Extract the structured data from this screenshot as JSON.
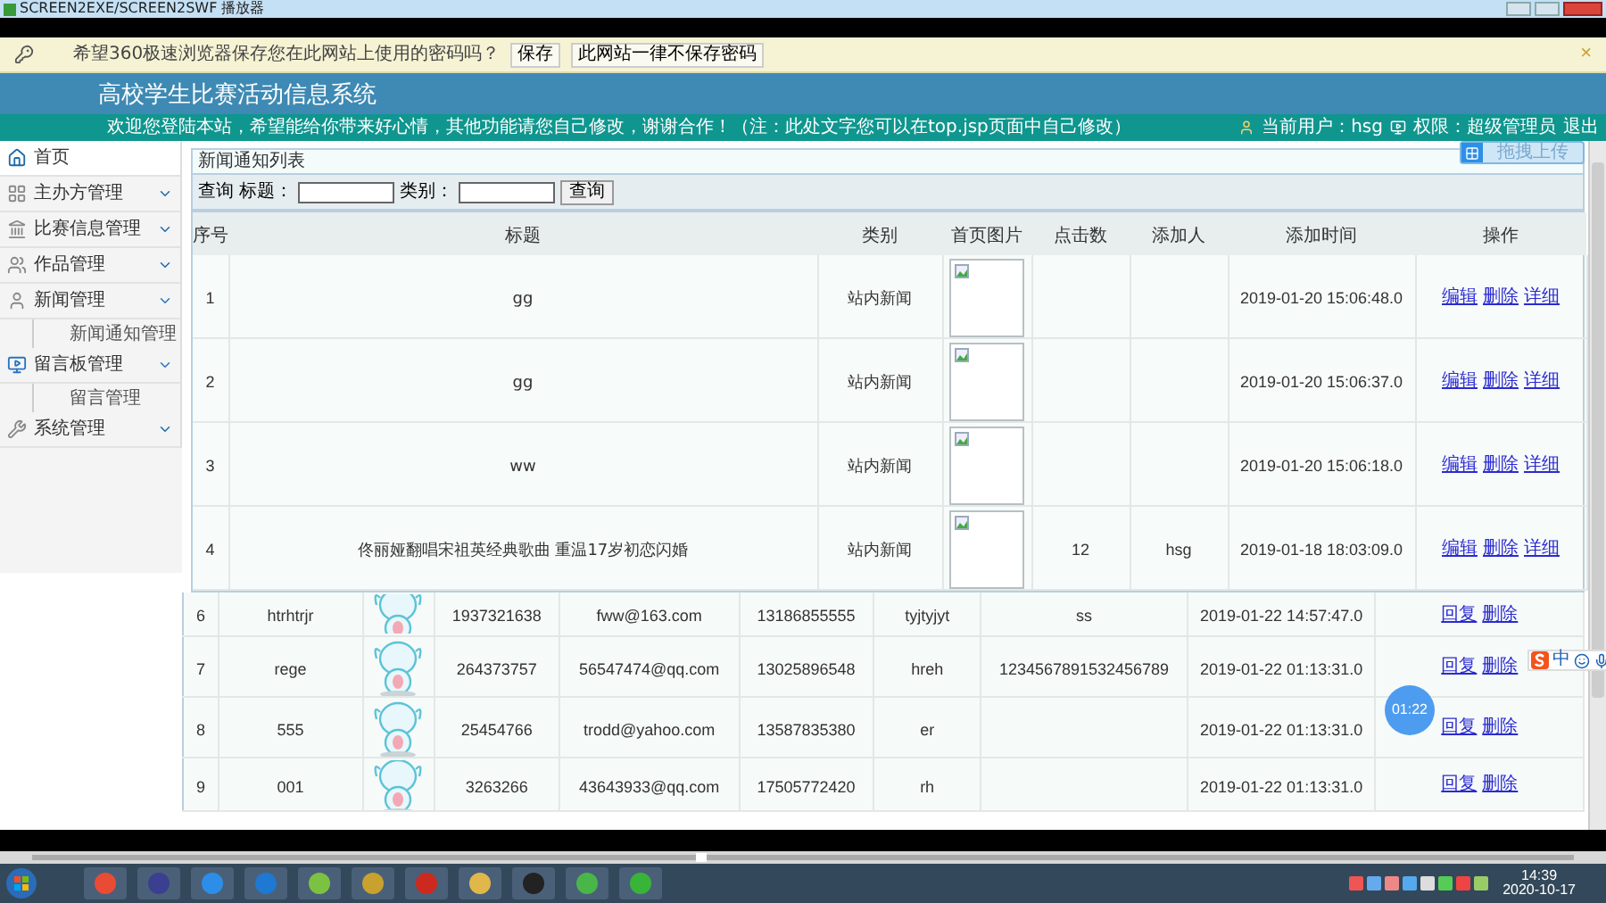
{
  "player_window": {
    "title": "SCREEN2EXE/SCREEN2SWF 播放器"
  },
  "password_bar": {
    "message": "希望360极速浏览器保存您在此网站上使用的密码吗？",
    "buttons": [
      "保存",
      "此网站一律不保存密码"
    ],
    "close": "×"
  },
  "header": {
    "title": "高校学生比赛活动信息系统",
    "welcome": "欢迎您登陆本站，希望能给你带来好心情，其他功能请您自己修改，谢谢合作！（注：此处文字您可以在top.jsp页面中自己修改）",
    "user_label": "当前用户：",
    "user": "hsg",
    "role_label": "权限：",
    "role": "超级管理员",
    "logout": "退出"
  },
  "upload_button": "拖拽上传",
  "sidebar": {
    "items": [
      {
        "label": "首页",
        "kind": "home"
      },
      {
        "label": "主办方管理",
        "kind": "menu",
        "expanded": false
      },
      {
        "label": "比赛信息管理",
        "kind": "menu",
        "expanded": false
      },
      {
        "label": "作品管理",
        "kind": "menu",
        "expanded": false
      },
      {
        "label": "新闻管理",
        "kind": "menu",
        "expanded": true,
        "children": [
          {
            "label": "新闻通知管理"
          }
        ]
      },
      {
        "label": "留言板管理",
        "kind": "menu",
        "expanded": true,
        "children": [
          {
            "label": "留言管理"
          }
        ]
      },
      {
        "label": "系统管理",
        "kind": "menu",
        "expanded": false
      }
    ]
  },
  "news_list": {
    "title": "新闻通知列表",
    "search": {
      "label": "查询",
      "fields": [
        {
          "label": "标题："
        },
        {
          "label": "类别："
        }
      ],
      "button": "查询"
    },
    "columns": [
      "序号",
      "标题",
      "类别",
      "首页图片",
      "点击数",
      "添加人",
      "添加时间",
      "操作"
    ],
    "rows": [
      {
        "no": "1",
        "title": "gg",
        "category": "站内新闻",
        "time": "2019-01-20 15:06:48.0",
        "actions": [
          "编辑",
          "删除",
          "详细"
        ]
      },
      {
        "no": "2",
        "title": "gg",
        "category": "站内新闻",
        "time": "2019-01-20 15:06:37.0",
        "actions": [
          "编辑",
          "删除",
          "详细"
        ]
      },
      {
        "no": "3",
        "title": "ww",
        "category": "站内新闻",
        "time": "2019-01-20 15:06:18.0",
        "actions": [
          "编辑",
          "删除",
          "详细"
        ]
      },
      {
        "no": "4",
        "title": "佟丽娅翻唱宋祖英经典歌曲 重温17岁初恋闪婚",
        "category": "站内新闻",
        "clicks": "12",
        "added_by": "hsg",
        "time": "2019-01-18 18:03:09.0",
        "actions": [
          "编辑",
          "删除",
          "详细"
        ]
      }
    ]
  },
  "message_list": {
    "rows": [
      {
        "no": "6",
        "name": "htrhtrjr",
        "qq": "1937321638",
        "email": "fww@163.com",
        "phone": "13186855555",
        "column_6": "tyjtyjyt",
        "column_7": "ss",
        "time": "2019-01-22 14:57:47.0",
        "actions": [
          "回复",
          "删除"
        ]
      },
      {
        "no": "7",
        "name": "rege",
        "qq": "264373757",
        "email": "56547474@qq.com",
        "phone": "13025896548",
        "column_6": "hreh",
        "column_7": "1234567891532456789",
        "time": "2019-01-22 01:13:31.0",
        "actions": [
          "回复",
          "删除"
        ]
      },
      {
        "no": "8",
        "name": "555",
        "qq": "25454766",
        "email": "trodd@yahoo.com",
        "phone": "13587835380",
        "column_6": "er",
        "time": "2019-01-22 01:13:31.0",
        "actions": [
          "回复",
          "删除"
        ]
      },
      {
        "no": "9",
        "name": "001",
        "qq": "3263266",
        "email": "43643933@qq.com",
        "phone": "17505772420",
        "column_6": "rh",
        "time": "2019-01-22 01:13:31.0",
        "actions": [
          "回复",
          "删除"
        ]
      }
    ]
  },
  "ime_toolbar": {
    "mode": "中"
  },
  "recording_timer": "01:22",
  "taskbar": {
    "time": "14:39",
    "date": "2020-10-17"
  }
}
